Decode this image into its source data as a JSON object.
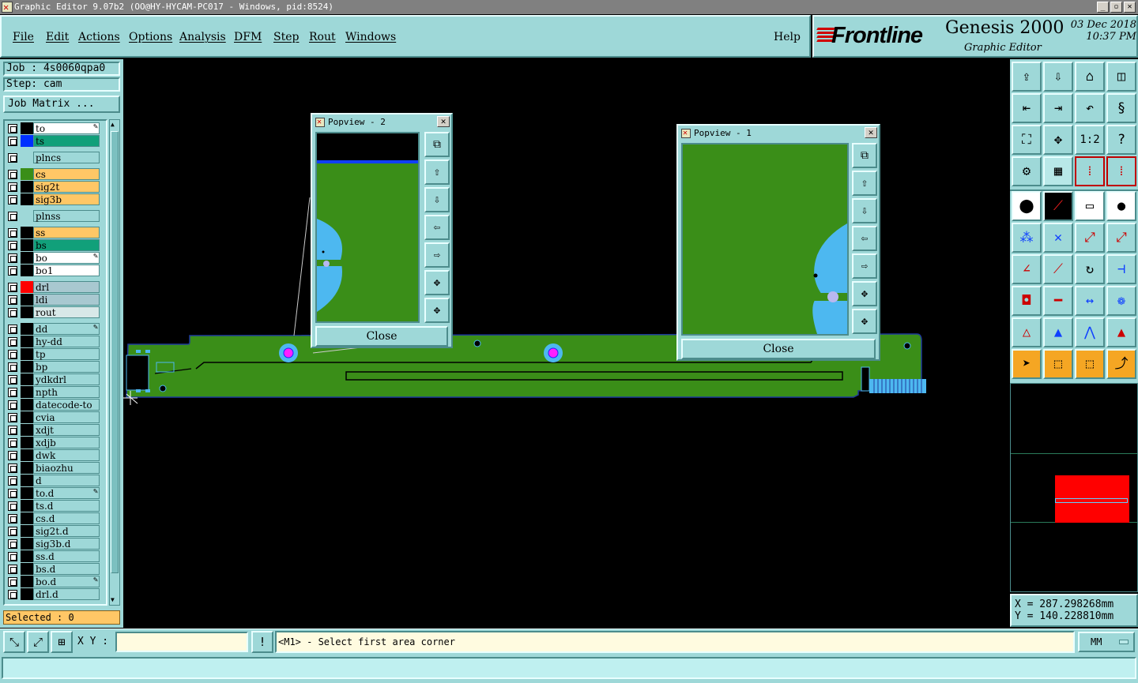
{
  "window": {
    "title": "Graphic Editor 9.07b2 (OO@HY-HYCAM-PC017 - Windows, pid:8524)",
    "controls": [
      "_",
      "▫",
      "✕"
    ]
  },
  "menu": {
    "items": [
      "File",
      "Edit",
      "Actions",
      "Options",
      "Analysis",
      "DFM",
      "Step",
      "Rout",
      "Windows"
    ],
    "help": "Help"
  },
  "brand": {
    "logo": "Frontline",
    "product": "Genesis 2000",
    "subtitle": "Graphic Editor",
    "date": "03 Dec 2018",
    "time": "10:37 PM"
  },
  "job": {
    "job_label": "Job : 4s0060qpa0",
    "step_label": "Step: cam",
    "matrix_button": "Job Matrix ..."
  },
  "layers": [
    {
      "name": "to",
      "swatch": "#000000",
      "color": "#ffffff",
      "edit": true
    },
    {
      "name": "ts",
      "swatch": "#0030ff",
      "color": "#11a07a",
      "edit": false
    },
    {
      "name": "plncs",
      "swatch": "",
      "color": "#9ed8d8",
      "edit": false
    },
    {
      "name": "cs",
      "swatch": "#3a8e18",
      "color": "#ffc766",
      "edit": false
    },
    {
      "name": "sig2t",
      "swatch": "#000000",
      "color": "#ffc766",
      "edit": false
    },
    {
      "name": "sig3b",
      "swatch": "#000000",
      "color": "#ffc766",
      "edit": false
    },
    {
      "name": "plnss",
      "swatch": "",
      "color": "#9ed8d8",
      "edit": false
    },
    {
      "name": "ss",
      "swatch": "#000000",
      "color": "#ffc766",
      "edit": false
    },
    {
      "name": "bs",
      "swatch": "#000000",
      "color": "#11a07a",
      "edit": false
    },
    {
      "name": "bo",
      "swatch": "#000000",
      "color": "#ffffff",
      "edit": true
    },
    {
      "name": "bo1",
      "swatch": "#000000",
      "color": "#ffffff",
      "edit": false
    },
    {
      "name": "drl",
      "swatch": "#ff0000",
      "color": "#a8c8d0",
      "edit": false
    },
    {
      "name": "ldi",
      "swatch": "#000000",
      "color": "#a8c8d0",
      "edit": false
    },
    {
      "name": "rout",
      "swatch": "#000000",
      "color": "#d8e8e8",
      "edit": false
    },
    {
      "name": "dd",
      "swatch": "#000000",
      "color": "#9ed8d8",
      "edit": true
    },
    {
      "name": "hy-dd",
      "swatch": "#000000",
      "color": "#9ed8d8",
      "edit": false
    },
    {
      "name": "tp",
      "swatch": "#000000",
      "color": "#9ed8d8",
      "edit": false
    },
    {
      "name": "bp",
      "swatch": "#000000",
      "color": "#9ed8d8",
      "edit": false
    },
    {
      "name": "ydkdrl",
      "swatch": "#000000",
      "color": "#9ed8d8",
      "edit": false
    },
    {
      "name": "npth",
      "swatch": "#000000",
      "color": "#9ed8d8",
      "edit": false
    },
    {
      "name": "datecode-to",
      "swatch": "#000000",
      "color": "#9ed8d8",
      "edit": false
    },
    {
      "name": "cvia",
      "swatch": "#000000",
      "color": "#9ed8d8",
      "edit": false
    },
    {
      "name": "xdjt",
      "swatch": "#000000",
      "color": "#9ed8d8",
      "edit": false
    },
    {
      "name": "xdjb",
      "swatch": "#000000",
      "color": "#9ed8d8",
      "edit": false
    },
    {
      "name": "dwk",
      "swatch": "#000000",
      "color": "#9ed8d8",
      "edit": false
    },
    {
      "name": "biaozhu",
      "swatch": "#000000",
      "color": "#9ed8d8",
      "edit": false
    },
    {
      "name": "d",
      "swatch": "#000000",
      "color": "#9ed8d8",
      "edit": false
    },
    {
      "name": "to.d",
      "swatch": "#000000",
      "color": "#9ed8d8",
      "edit": true
    },
    {
      "name": "ts.d",
      "swatch": "#000000",
      "color": "#9ed8d8",
      "edit": false
    },
    {
      "name": "cs.d",
      "swatch": "#000000",
      "color": "#9ed8d8",
      "edit": false
    },
    {
      "name": "sig2t.d",
      "swatch": "#000000",
      "color": "#9ed8d8",
      "edit": false
    },
    {
      "name": "sig3b.d",
      "swatch": "#000000",
      "color": "#9ed8d8",
      "edit": false
    },
    {
      "name": "ss.d",
      "swatch": "#000000",
      "color": "#9ed8d8",
      "edit": false
    },
    {
      "name": "bs.d",
      "swatch": "#000000",
      "color": "#9ed8d8",
      "edit": false
    },
    {
      "name": "bo.d",
      "swatch": "#000000",
      "color": "#9ed8d8",
      "edit": true
    },
    {
      "name": "drl.d",
      "swatch": "#000000",
      "color": "#9ed8d8",
      "edit": false
    }
  ],
  "selected": "Selected : 0",
  "popview2": {
    "title": "Popview - 2",
    "close": "Close"
  },
  "popview1": {
    "title": "Popview - 1",
    "close": "Close"
  },
  "tools": {
    "scale_label": "1:2",
    "help_glyph": "?"
  },
  "coords": {
    "x": "X  =  287.298268mm",
    "y": "Y  =  140.228810mm"
  },
  "status": {
    "xy_label": "X Y :",
    "xy_value": "",
    "alert_glyph": "!",
    "prompt": "<M1> - Select first area corner",
    "units": "MM"
  },
  "colors": {
    "panel": "#9ed8d8",
    "board": "#3a8e18",
    "copper_alt": "#4db8f0",
    "drill": "#ff20ff",
    "highlight": "#ffc766"
  }
}
